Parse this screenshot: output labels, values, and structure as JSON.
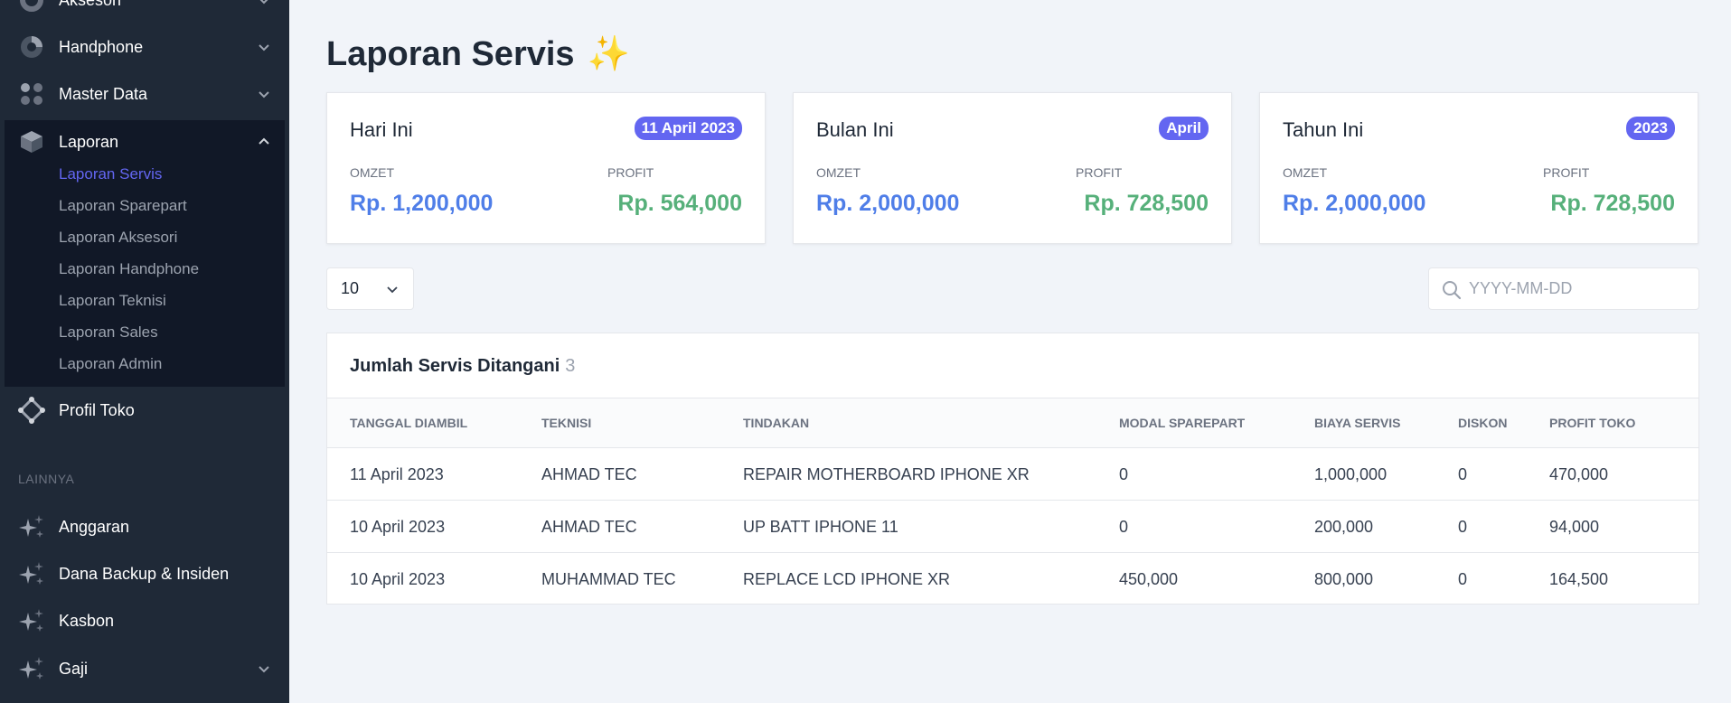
{
  "colors": {
    "sidebar_bg": "#1f2937",
    "submenu_bg": "#111827",
    "accent": "#6366f1",
    "omzet": "#4f7ee8",
    "profit": "#56b07a",
    "page_bg": "#f1f4f9"
  },
  "sidebar": {
    "items_top": [
      {
        "label": "Aksesori",
        "icon": "donut-chart-icon",
        "expanded": false
      },
      {
        "label": "Handphone",
        "icon": "pie-chart-icon",
        "expanded": false
      },
      {
        "label": "Master Data",
        "icon": "grid-dots-icon",
        "expanded": false
      },
      {
        "label": "Laporan",
        "icon": "cube-icon",
        "expanded": true
      }
    ],
    "laporan_sub": [
      {
        "label": "Laporan Servis",
        "active": true
      },
      {
        "label": "Laporan Sparepart",
        "active": false
      },
      {
        "label": "Laporan Aksesori",
        "active": false
      },
      {
        "label": "Laporan Handphone",
        "active": false
      },
      {
        "label": "Laporan Teknisi",
        "active": false
      },
      {
        "label": "Laporan Sales",
        "active": false
      },
      {
        "label": "Laporan Admin",
        "active": false
      }
    ],
    "profil_toko": {
      "label": "Profil Toko",
      "icon": "diamond-nodes-icon"
    },
    "section_label": "LAINNYA",
    "items_bottom": [
      {
        "label": "Anggaran",
        "icon": "sparkles-icon"
      },
      {
        "label": "Dana Backup & Insiden",
        "icon": "sparkles-icon"
      },
      {
        "label": "Kasbon",
        "icon": "sparkles-icon"
      },
      {
        "label": "Gaji",
        "icon": "sparkles-icon",
        "expanded": false
      }
    ]
  },
  "page": {
    "title": "Laporan Servis",
    "title_emoji": "✨"
  },
  "cards": [
    {
      "title": "Hari Ini",
      "badge": "11 April 2023",
      "omzet_label": "OMZET",
      "omzet_value": "Rp. 1,200,000",
      "profit_label": "PROFIT",
      "profit_value": "Rp. 564,000"
    },
    {
      "title": "Bulan Ini",
      "badge": "April",
      "omzet_label": "OMZET",
      "omzet_value": "Rp. 2,000,000",
      "profit_label": "PROFIT",
      "profit_value": "Rp. 728,500"
    },
    {
      "title": "Tahun Ini",
      "badge": "2023",
      "omzet_label": "OMZET",
      "omzet_value": "Rp. 2,000,000",
      "profit_label": "PROFIT",
      "profit_value": "Rp. 728,500"
    }
  ],
  "controls": {
    "page_size": "10",
    "search_placeholder": "YYYY-MM-DD",
    "search_value": ""
  },
  "table": {
    "title": "Jumlah Servis Ditangani",
    "count": "3",
    "columns": [
      "TANGGAL DIAMBIL",
      "TEKNISI",
      "TINDAKAN",
      "MODAL SPAREPART",
      "BIAYA SERVIS",
      "DISKON",
      "PROFIT TOKO"
    ],
    "rows": [
      [
        "11 April 2023",
        "AHMAD TEC",
        "REPAIR MOTHERBOARD IPHONE XR",
        "0",
        "1,000,000",
        "0",
        "470,000"
      ],
      [
        "10 April 2023",
        "AHMAD TEC",
        "UP BATT IPHONE 11",
        "0",
        "200,000",
        "0",
        "94,000"
      ],
      [
        "10 April 2023",
        "MUHAMMAD TEC",
        "REPLACE LCD IPHONE XR",
        "450,000",
        "800,000",
        "0",
        "164,500"
      ]
    ]
  }
}
